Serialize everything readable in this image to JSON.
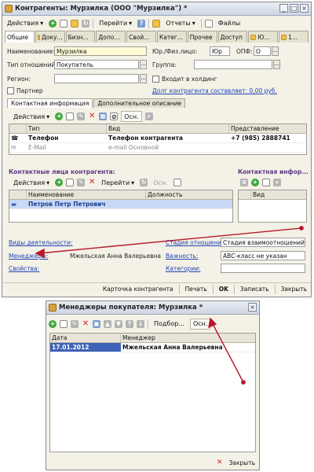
{
  "main_window": {
    "title": "Контрагенты: Мурзилка (ООО \"Мурзилка\") *",
    "toolbar": {
      "actions": "Действия",
      "goto": "Перейти",
      "reports": "Отчеты",
      "files": "Файлы"
    },
    "tabs": [
      "Общие",
      "Доку...",
      "Бизн...",
      "Допо...",
      "Свой...",
      "Катег...",
      "Прочее",
      "Доступ",
      "Ю...",
      "1..."
    ],
    "fields": {
      "name_label": "Наименование:",
      "name_value": "Мурзилка",
      "relation_label": "Тип отношений:",
      "relation_value": "Покупатель",
      "region_label": "Регион:",
      "region_value": "",
      "partner_label": "Партнер",
      "legal_label": "Юр./Физ.лицо:",
      "legal_value": "Юр",
      "opf_label": "ОПФ:",
      "opf_value": "О",
      "group_label": "Группа:",
      "group_value": "",
      "holding_label": "Входит в холдинг",
      "debt_link": "Долг контрагента составляет: 0,00 руб."
    },
    "contact_tabs": [
      "Контактная информация",
      "Дополнительное описание"
    ],
    "contact_toolbar": {
      "actions": "Действия",
      "osn": "Осн."
    },
    "contact_table": {
      "headers": [
        "Тип",
        "Вид",
        "Представление"
      ],
      "rows": [
        {
          "type": "Телефон",
          "kind": "Телефон контрагента",
          "value": "+7 (985) 2888741"
        },
        {
          "type": "E-Mail",
          "kind": "e-mail  Основной",
          "value": ""
        }
      ]
    },
    "persons": {
      "title": "Контактные лица контрагента:",
      "actions": "Действия",
      "goto": "Перейти",
      "osn": "Осн.",
      "headers": [
        "Наименование",
        "Должность"
      ],
      "rows": [
        {
          "name": "Петров Петр Петрович",
          "position": ""
        }
      ]
    },
    "contact_info_side": {
      "title": "Контактная инфор...",
      "header": "Вид"
    },
    "bottom": {
      "activity_link": "Виды деятельности:",
      "managers_link": "Менеджеры:",
      "managers_value": "Мжельская Анна Валерьевна",
      "props_link": "Свойства:",
      "stage_link": "Стадия отношений:",
      "stage_value": "Стадия взаимоотношений",
      "importance_link": "Важность:",
      "importance_value": "АВС-класс не указан",
      "categories_link": "Категории:"
    },
    "statusbar": {
      "card": "Карточка контрагента",
      "print": "Печать",
      "ok": "OK",
      "save": "Записать",
      "close": "Закрыть"
    }
  },
  "dialog": {
    "title": "Менеджеры покупателя: Мурзилка *",
    "toolbar": {
      "pick": "Подбор...",
      "osn": "Осн."
    },
    "headers": [
      "Дата",
      "Менеджер"
    ],
    "rows": [
      {
        "date": "17.01.2012",
        "manager": "Мжельская Анна Валерьевна"
      }
    ],
    "close": "Закрыть"
  },
  "colors": {
    "arrow": "#b5192c",
    "link": "#1f46b4",
    "selection": "#c9d9f5"
  }
}
